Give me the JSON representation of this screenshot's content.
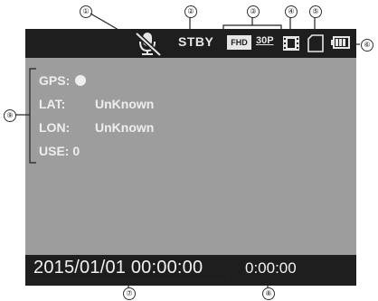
{
  "callouts": [
    "①",
    "②",
    "③",
    "④",
    "⑤",
    "⑥",
    "⑦",
    "⑧",
    "⑨"
  ],
  "status": {
    "mode": "STBY",
    "resolution": "FHD",
    "frame_rate": "30P"
  },
  "info": {
    "gps_label": "GPS:",
    "lat_label": "LAT:",
    "lat_value": "UnKnown",
    "lon_label": "LON:",
    "lon_value": "UnKnown",
    "use_label": "USE:",
    "use_value": "0"
  },
  "datetime": "2015/01/01 00:00:00",
  "timer": "0:00:00",
  "icons": [
    "microphone-muted-icon",
    "film-icon",
    "sd-card-icon",
    "battery-icon"
  ],
  "colors": {
    "screen": "#9d9d9d",
    "bar": "#1e1e1e",
    "text": "#eeeeee"
  }
}
